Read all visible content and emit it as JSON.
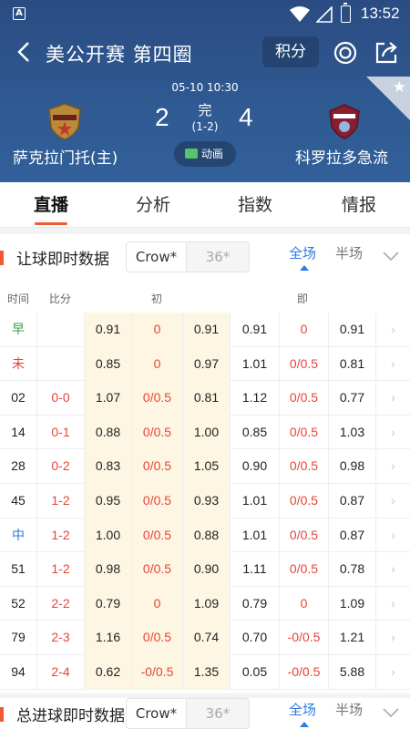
{
  "status_bar": {
    "time": "13:52"
  },
  "header": {
    "title": "美公开赛 第四圈",
    "jifen_label": "积分",
    "datetime": "05-10 10:30",
    "home_score": "2",
    "away_score": "4",
    "status": "完",
    "half_score": "(1-2)",
    "anim_label": "动画",
    "home_team": "萨克拉门托(主)",
    "away_team": "科罗拉多急流"
  },
  "tabs": [
    {
      "label": "直播"
    },
    {
      "label": "分析"
    },
    {
      "label": "指数"
    },
    {
      "label": "情报"
    }
  ],
  "section1": {
    "title": "让球即时数据",
    "seg_a": "Crow*",
    "seg_b": "36*",
    "opt_full": "全场",
    "opt_half": "半场",
    "col_time": "时间",
    "col_score": "比分",
    "col_init": "初",
    "col_live": "即",
    "rows": [
      {
        "time": "早",
        "score": "",
        "i1": "0.91",
        "i2": "0",
        "i3": "0.91",
        "l1": "0.91",
        "l2": "0",
        "l3": "0.91"
      },
      {
        "time": "未",
        "score": "",
        "i1": "0.85",
        "i2": "0",
        "i3": "0.97",
        "l1": "1.01",
        "l2": "0/0.5",
        "l3": "0.81"
      },
      {
        "time": "02",
        "score": "0-0",
        "i1": "1.07",
        "i2": "0/0.5",
        "i3": "0.81",
        "l1": "1.12",
        "l2": "0/0.5",
        "l3": "0.77"
      },
      {
        "time": "14",
        "score": "0-1",
        "i1": "0.88",
        "i2": "0/0.5",
        "i3": "1.00",
        "l1": "0.85",
        "l2": "0/0.5",
        "l3": "1.03"
      },
      {
        "time": "28",
        "score": "0-2",
        "i1": "0.83",
        "i2": "0/0.5",
        "i3": "1.05",
        "l1": "0.90",
        "l2": "0/0.5",
        "l3": "0.98"
      },
      {
        "time": "45",
        "score": "1-2",
        "i1": "0.95",
        "i2": "0/0.5",
        "i3": "0.93",
        "l1": "1.01",
        "l2": "0/0.5",
        "l3": "0.87"
      },
      {
        "time": "中",
        "score": "1-2",
        "i1": "1.00",
        "i2": "0/0.5",
        "i3": "0.88",
        "l1": "1.01",
        "l2": "0/0.5",
        "l3": "0.87"
      },
      {
        "time": "51",
        "score": "1-2",
        "i1": "0.98",
        "i2": "0/0.5",
        "i3": "0.90",
        "l1": "1.11",
        "l2": "0/0.5",
        "l3": "0.78"
      },
      {
        "time": "52",
        "score": "2-2",
        "i1": "0.79",
        "i2": "0",
        "i3": "1.09",
        "l1": "0.79",
        "l2": "0",
        "l3": "1.09"
      },
      {
        "time": "79",
        "score": "2-3",
        "i1": "1.16",
        "i2": "0/0.5",
        "i3": "0.74",
        "l1": "0.70",
        "l2": "-0/0.5",
        "l3": "1.21"
      },
      {
        "time": "94",
        "score": "2-4",
        "i1": "0.62",
        "i2": "-0/0.5",
        "i3": "1.35",
        "l1": "0.05",
        "l2": "-0/0.5",
        "l3": "5.88"
      }
    ]
  },
  "section2": {
    "title": "总进球即时数据",
    "seg_a": "Crow*",
    "seg_b": "36*",
    "opt_full": "全场",
    "opt_half": "半场"
  },
  "colors": {
    "header_bg": "#2f5a92",
    "accent": "#ef5a33",
    "red": "#e8443a",
    "green": "#39a04d",
    "blue": "#2d7ae0",
    "init_bg": "#fdf6e3"
  },
  "arrow_glyph": "›"
}
